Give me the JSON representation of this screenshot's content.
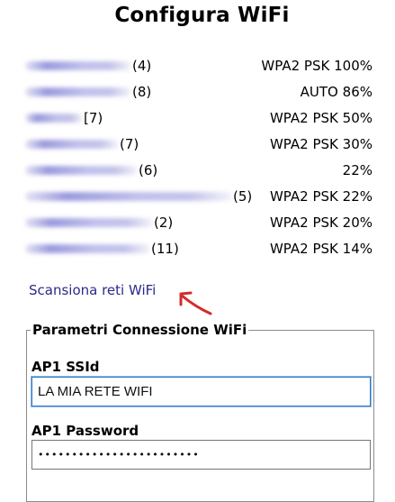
{
  "page": {
    "title": "Configura WiFi"
  },
  "networks": [
    {
      "count": "(4)",
      "security": "WPA2 PSK",
      "signal": "100%",
      "name_blur": 118
    },
    {
      "count": "(8)",
      "security": "AUTO",
      "signal": "86%",
      "name_blur": 118
    },
    {
      "count": "[7)",
      "security": "WPA2 PSK",
      "signal": "50%",
      "name_blur": 64
    },
    {
      "count": "(7)",
      "security": "WPA2 PSK",
      "signal": "30%",
      "name_blur": 104
    },
    {
      "count": "(6)",
      "security": "",
      "signal": "22%",
      "name_blur": 125
    },
    {
      "count": "(5)",
      "security": "WPA2 PSK",
      "signal": "22%",
      "name_blur": 230
    },
    {
      "count": "(2)",
      "security": "WPA2 PSK",
      "signal": "20%",
      "name_blur": 142
    },
    {
      "count": "(11)",
      "security": "WPA2 PSK",
      "signal": "14%",
      "name_blur": 139
    }
  ],
  "scan_link": "Scansiona reti WiFi",
  "params": {
    "legend": "Parametri Connessione WiFi",
    "ssid_label": "AP1 SSId",
    "ssid_value": "LA MIA RETE WIFI",
    "password_label": "AP1 Password",
    "password_value": "••••••••••••••••••••••••"
  },
  "icons": {
    "annotation": "red-arrow-icon"
  },
  "colors": {
    "link": "#2a2a8a",
    "arrow": "#d32b2b",
    "input_focus": "#2b78c5"
  }
}
